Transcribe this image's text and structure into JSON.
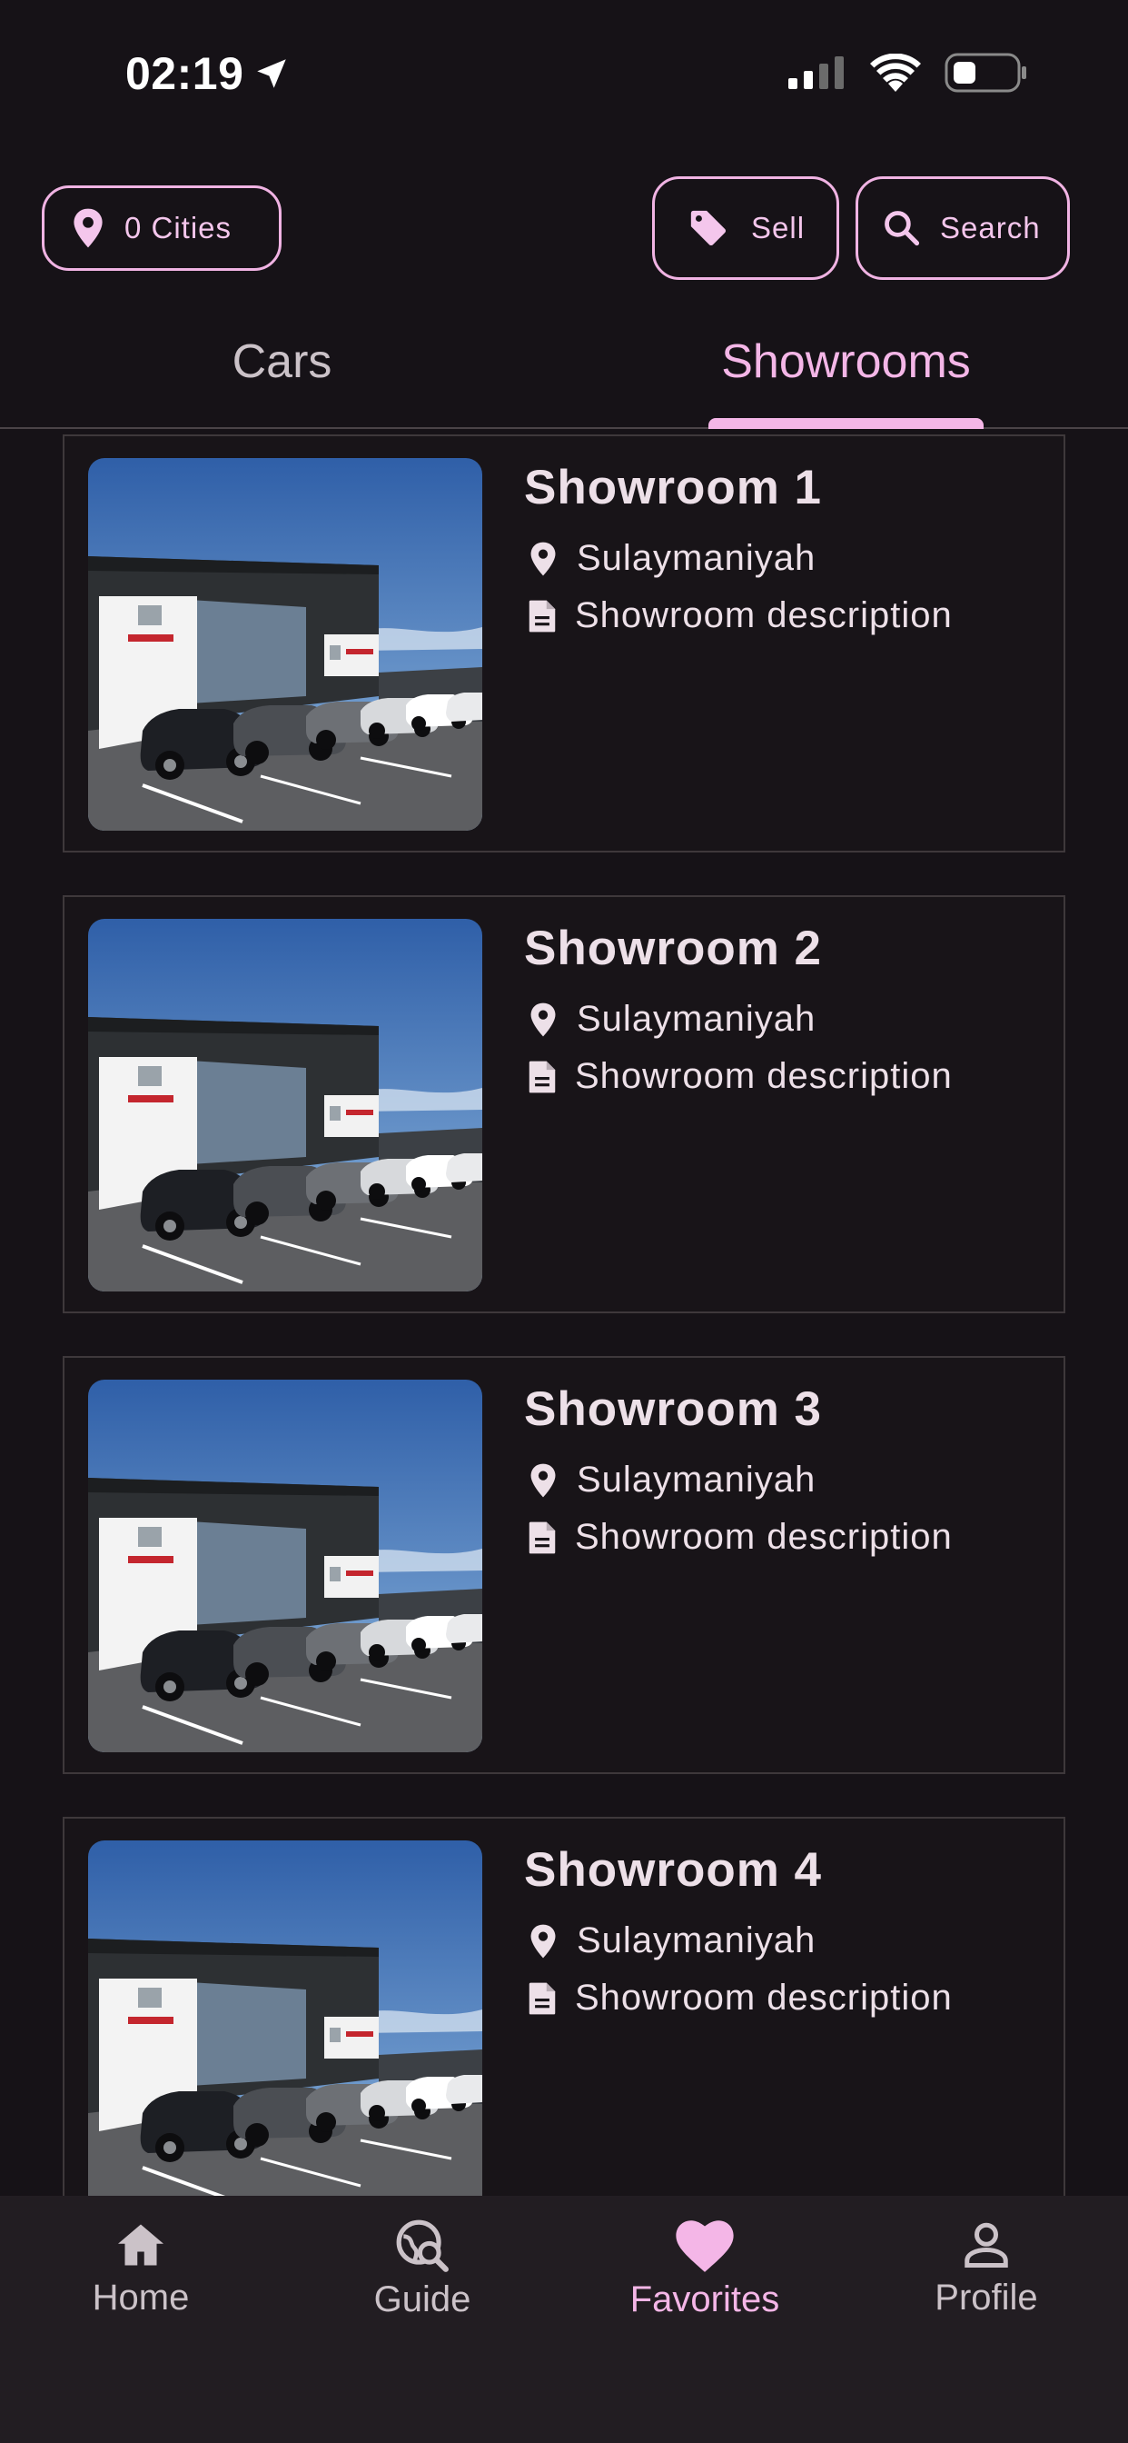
{
  "status_bar": {
    "time": "02:19",
    "location_icon": "navigation-arrow-icon",
    "signal_icon": "cellular-signal-icon",
    "wifi_icon": "wifi-icon",
    "battery_icon": "battery-icon"
  },
  "header": {
    "cities_label": "0 Cities",
    "sell_label": "Sell",
    "search_label": "Search"
  },
  "tabs": [
    {
      "label": "Cars",
      "active": false
    },
    {
      "label": "Showrooms",
      "active": true
    }
  ],
  "showrooms": [
    {
      "title": "Showroom 1",
      "city": "Sulaymaniyah",
      "description": "Showroom description"
    },
    {
      "title": "Showroom 2",
      "city": "Sulaymaniyah",
      "description": "Showroom description"
    },
    {
      "title": "Showroom 3",
      "city": "Sulaymaniyah",
      "description": "Showroom description"
    },
    {
      "title": "Showroom 4",
      "city": "Sulaymaniyah",
      "description": "Showroom description"
    }
  ],
  "bottom_nav": [
    {
      "label": "Home",
      "icon": "home-icon",
      "active": false
    },
    {
      "label": "Guide",
      "icon": "guide-icon",
      "active": false
    },
    {
      "label": "Favorites",
      "icon": "heart-icon",
      "active": true
    },
    {
      "label": "Profile",
      "icon": "profile-icon",
      "active": false
    }
  ],
  "colors": {
    "background": "#161217",
    "accent": "#f4b6e7",
    "text": "#ede0e8",
    "muted_text": "#cbc2c8",
    "nav_background": "#221d22"
  }
}
